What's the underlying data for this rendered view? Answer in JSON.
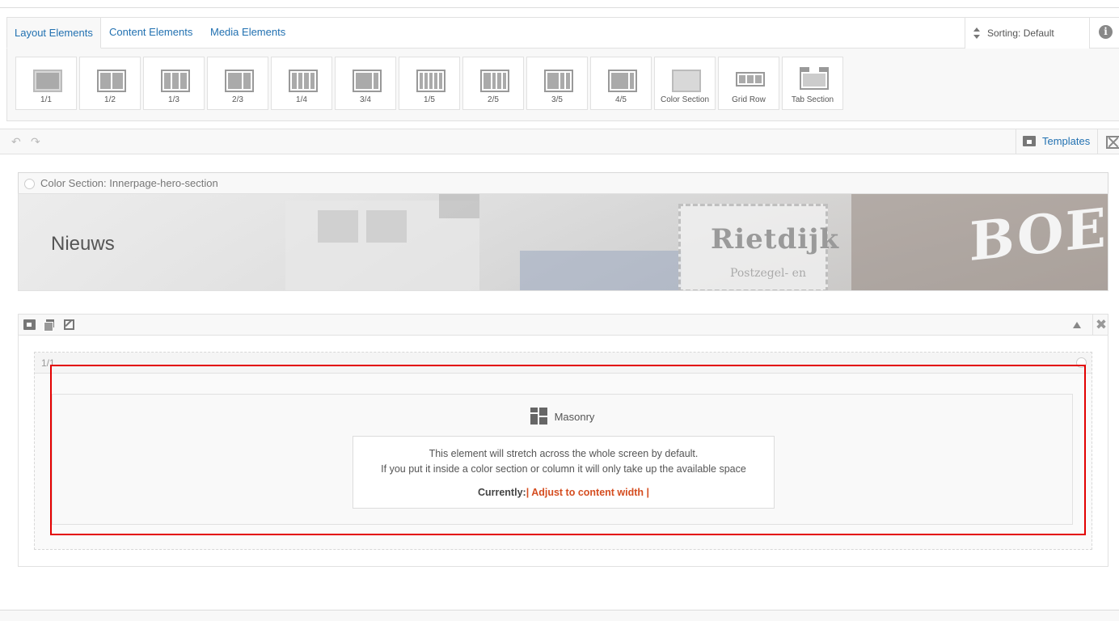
{
  "tabs": [
    {
      "label": "Layout Elements",
      "active": true
    },
    {
      "label": "Content Elements",
      "active": false
    },
    {
      "label": "Media Elements",
      "active": false
    }
  ],
  "sorting": {
    "label": "Sorting: Default"
  },
  "info_icon_glyph": "i",
  "layout_elements": [
    {
      "label": "1/1",
      "icon": "column-1-1-icon"
    },
    {
      "label": "1/2",
      "icon": "column-1-2-icon"
    },
    {
      "label": "1/3",
      "icon": "column-1-3-icon"
    },
    {
      "label": "2/3",
      "icon": "column-2-3-icon"
    },
    {
      "label": "1/4",
      "icon": "column-1-4-icon"
    },
    {
      "label": "3/4",
      "icon": "column-3-4-icon"
    },
    {
      "label": "1/5",
      "icon": "column-1-5-icon"
    },
    {
      "label": "2/5",
      "icon": "column-2-5-icon"
    },
    {
      "label": "3/5",
      "icon": "column-3-5-icon"
    },
    {
      "label": "4/5",
      "icon": "column-4-5-icon"
    },
    {
      "label": "Color Section",
      "icon": "color-section-icon"
    },
    {
      "label": "Grid Row",
      "icon": "grid-row-icon"
    },
    {
      "label": "Tab Section",
      "icon": "tab-section-icon"
    }
  ],
  "toolbar": {
    "undo_glyph": "↶",
    "redo_glyph": "↷",
    "templates_label": "Templates"
  },
  "color_section": {
    "header": "Color Section: Innerpage-hero-section",
    "title": "Nieuws",
    "brand_text": "Rietdijk",
    "sub_text": "Postzegel- en",
    "sign_text": "BOEK"
  },
  "section": {
    "close_glyph": "✖"
  },
  "column": {
    "label": "1/1"
  },
  "masonry": {
    "title": "Masonry",
    "line1": "This element will stretch across the whole screen by default.",
    "line2": "If you put it inside a color section or column it will only take up the available space",
    "current_label": "Currently:",
    "current_value": "| Adjust to content width |"
  },
  "colors": {
    "link": "#2271b1",
    "accent": "#d54e21",
    "highlight": "#e30000"
  }
}
